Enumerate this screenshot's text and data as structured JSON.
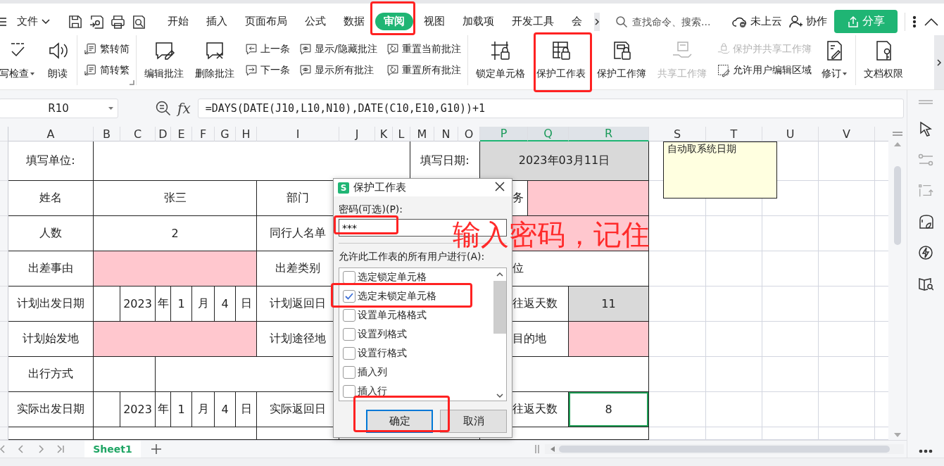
{
  "menu_bar": {
    "file_menu": "文件",
    "tabs": [
      {
        "label": "开始",
        "selected": false
      },
      {
        "label": "插入",
        "selected": false
      },
      {
        "label": "页面布局",
        "selected": false
      },
      {
        "label": "公式",
        "selected": false
      },
      {
        "label": "数据",
        "selected": false
      },
      {
        "label": "审阅",
        "selected": true
      },
      {
        "label": "视图",
        "selected": false
      },
      {
        "label": "加载项",
        "selected": false
      },
      {
        "label": "开发工具",
        "selected": false
      },
      {
        "label": "会",
        "selected": false
      }
    ],
    "search": {
      "placeholder": "查找命令、搜索..."
    },
    "cloud_status": "未上云",
    "collaborate": "协作",
    "share": "分享"
  },
  "ribbon": {
    "groups": [
      {
        "items": [
          {
            "kind": "large",
            "label": "写检查",
            "dropdown": true,
            "disabled": false
          },
          {
            "kind": "large",
            "label": "朗读",
            "dropdown": false,
            "disabled": false
          }
        ]
      },
      {
        "items": [
          {
            "kind": "small",
            "label": "繁转简",
            "dropdown": false,
            "disabled": false
          },
          {
            "kind": "small",
            "label": "简转繁",
            "dropdown": false,
            "disabled": false
          }
        ]
      },
      {
        "items": [
          {
            "kind": "large",
            "label": "编辑批注",
            "dropdown": false,
            "disabled": false
          },
          {
            "kind": "large",
            "label": "删除批注",
            "dropdown": false,
            "disabled": false
          },
          {
            "kind": "small",
            "label": "上一条",
            "dropdown": false,
            "disabled": false
          },
          {
            "kind": "small",
            "label": "下一条",
            "dropdown": false,
            "disabled": false
          },
          {
            "kind": "small",
            "label": "显示/隐藏批注",
            "dropdown": false,
            "disabled": false
          },
          {
            "kind": "small",
            "label": "显示所有批注",
            "dropdown": false,
            "disabled": false
          },
          {
            "kind": "small",
            "label": "重置当前批注",
            "dropdown": false,
            "disabled": false
          },
          {
            "kind": "small",
            "label": "重置所有批注",
            "dropdown": false,
            "disabled": false
          }
        ]
      },
      {
        "items": [
          {
            "kind": "large",
            "label": "锁定单元格",
            "dropdown": false,
            "disabled": false
          },
          {
            "kind": "large",
            "label": "保护工作表",
            "dropdown": false,
            "disabled": false
          },
          {
            "kind": "large",
            "label": "保护工作簿",
            "dropdown": false,
            "disabled": false
          },
          {
            "kind": "large",
            "label": "共享工作簿",
            "dropdown": false,
            "disabled": true
          },
          {
            "kind": "small",
            "label": "保护并共享工作簿",
            "dropdown": false,
            "disabled": true
          },
          {
            "kind": "small",
            "label": "允许用户编辑区域",
            "dropdown": false,
            "disabled": false
          },
          {
            "kind": "large",
            "label": "修订",
            "dropdown": true,
            "disabled": false
          }
        ]
      },
      {
        "items": [
          {
            "kind": "large",
            "label": "文档权限",
            "dropdown": false,
            "disabled": false
          }
        ]
      }
    ]
  },
  "formula_bar": {
    "cell_name": "R10",
    "function_label": "fx",
    "formula": "=DAYS(DATE(J10,L10,N10),DATE(C10,E10,G10))+1"
  },
  "sheet": {
    "columns": [
      {
        "label": "A",
        "selected": false
      },
      {
        "label": "B",
        "selected": false
      },
      {
        "label": "C",
        "selected": false
      },
      {
        "label": "D",
        "selected": false
      },
      {
        "label": "E",
        "selected": false
      },
      {
        "label": "F",
        "selected": false
      },
      {
        "label": "G",
        "selected": false
      },
      {
        "label": "H",
        "selected": false
      },
      {
        "label": "I",
        "selected": false
      },
      {
        "label": "J",
        "selected": false
      },
      {
        "label": "K",
        "selected": false
      },
      {
        "label": "L",
        "selected": false
      },
      {
        "label": "M",
        "selected": false
      },
      {
        "label": "N",
        "selected": false
      },
      {
        "label": "O",
        "selected": false
      },
      {
        "label": "P",
        "selected": true
      },
      {
        "label": "Q",
        "selected": true
      },
      {
        "label": "R",
        "selected": true
      },
      {
        "label": "S",
        "selected": false
      },
      {
        "label": "T",
        "selected": false
      },
      {
        "label": "U",
        "selected": false
      },
      {
        "label": "V",
        "selected": false
      }
    ],
    "rows": [
      {
        "cells": [
          {
            "text": "填写单位:",
            "kind": "label"
          },
          {
            "kind": "label"
          },
          "",
          "",
          "",
          "",
          "",
          "",
          "",
          "",
          "",
          "",
          {
            "text": "填写日期:",
            "kind": "label"
          },
          "",
          "",
          {
            "text": "2023年03月11日",
            "kind": "auto"
          },
          "",
          ""
        ]
      },
      {
        "cells": [
          {
            "text": "姓名",
            "kind": "label"
          },
          {
            "text": "张三",
            "kind": "label"
          },
          "",
          "",
          "",
          "",
          "",
          "",
          {
            "text": "部门",
            "kind": "label"
          },
          "",
          "",
          "",
          "",
          "",
          "",
          {
            "text": "务",
            "kind": "partly_hidden"
          },
          {
            "kind": "required"
          },
          ""
        ]
      },
      {
        "cells": [
          {
            "text": "人数",
            "kind": "label"
          },
          {
            "text": "2",
            "kind": "label"
          },
          "",
          "",
          "",
          "",
          "",
          "",
          {
            "text": "同行人名单",
            "kind": "label"
          },
          "",
          "",
          "",
          "",
          "",
          "",
          {
            "kind": "required"
          },
          "",
          ""
        ]
      },
      {
        "cells": [
          {
            "text": "出差事由",
            "kind": "label"
          },
          {
            "kind": "required"
          },
          "",
          "",
          "",
          "",
          "",
          "",
          {
            "text": "出差类别",
            "kind": "label"
          },
          "",
          "",
          "",
          "",
          "",
          "",
          {
            "text": "位",
            "kind": "partly_hidden"
          },
          "",
          ""
        ]
      },
      {
        "cells": [
          {
            "text": "计划出发日期",
            "kind": "label"
          },
          {
            "kind": "label"
          },
          {
            "text": "2023",
            "kind": "label"
          },
          {
            "text": "年",
            "kind": "label"
          },
          {
            "text": "1",
            "kind": "label"
          },
          {
            "text": "月",
            "kind": "label"
          },
          {
            "text": "4",
            "kind": "label"
          },
          {
            "text": "日",
            "kind": "label"
          },
          {
            "text": "计划返回日",
            "kind": "label"
          },
          "",
          "",
          "",
          "",
          "",
          "",
          {
            "text": "往返天数",
            "kind": "partly_hidden"
          },
          "",
          {
            "text": "11",
            "kind": "auto"
          }
        ]
      },
      {
        "cells": [
          {
            "text": "计划始发地",
            "kind": "label"
          },
          {
            "kind": "required"
          },
          "",
          "",
          "",
          "",
          "",
          "",
          {
            "text": "计划途径地",
            "kind": "label"
          },
          "",
          "",
          "",
          "",
          "",
          "",
          {
            "text": "目的地",
            "kind": "partly_hidden"
          },
          "",
          {
            "kind": "required"
          }
        ]
      },
      {
        "cells": [
          {
            "text": "出行方式",
            "kind": "label"
          },
          {
            "kind": "label"
          },
          "",
          {
            "kind": "label"
          },
          "",
          "",
          "",
          "",
          "",
          "",
          "",
          "",
          "",
          "",
          "",
          "",
          "",
          ""
        ]
      },
      {
        "cells": [
          {
            "text": "实际出发日期",
            "kind": "label"
          },
          {
            "kind": "label"
          },
          {
            "text": "2023",
            "kind": "label"
          },
          {
            "text": "年",
            "kind": "label"
          },
          {
            "text": "1",
            "kind": "label"
          },
          {
            "text": "月",
            "kind": "label"
          },
          {
            "text": "4",
            "kind": "label"
          },
          {
            "text": "日",
            "kind": "label"
          },
          {
            "text": "实际返回日",
            "kind": "label"
          },
          "",
          "",
          "",
          "",
          "",
          "",
          {
            "text": "往返天数",
            "kind": "partly_hidden"
          },
          "",
          {
            "text": "8",
            "kind": "active"
          }
        ]
      },
      {
        "cells": [
          {
            "kind": "label"
          },
          {
            "kind": "label"
          },
          "",
          "",
          "",
          "",
          "",
          "",
          {
            "kind": "label"
          },
          "",
          "",
          "",
          "",
          "",
          "",
          {
            "kind": "label"
          },
          "",
          ""
        ]
      }
    ],
    "note": "自动取系统日期"
  },
  "sheet_tabs": {
    "tabs": [
      {
        "label": "Sheet1",
        "selected": true
      }
    ]
  },
  "dialog": {
    "icon_text": "S",
    "title": "保护工作表",
    "password_label": "密码(可选)(P):",
    "password": "***",
    "permissions_label": "允许此工作表的所有用户进行(A):",
    "options": [
      {
        "label": "选定锁定单元格",
        "checked": false
      },
      {
        "label": "选定未锁定单元格",
        "checked": true
      },
      {
        "label": "设置单元格格式",
        "checked": false
      },
      {
        "label": "设置列格式",
        "checked": false
      },
      {
        "label": "设置行格式",
        "checked": false
      },
      {
        "label": "插入列",
        "checked": false
      },
      {
        "label": "插入行",
        "checked": false
      }
    ],
    "buttons": [
      {
        "label": "确定",
        "default": true
      },
      {
        "label": "取消",
        "default": false
      }
    ]
  },
  "annotation": {
    "text": "输入密码，记住"
  }
}
